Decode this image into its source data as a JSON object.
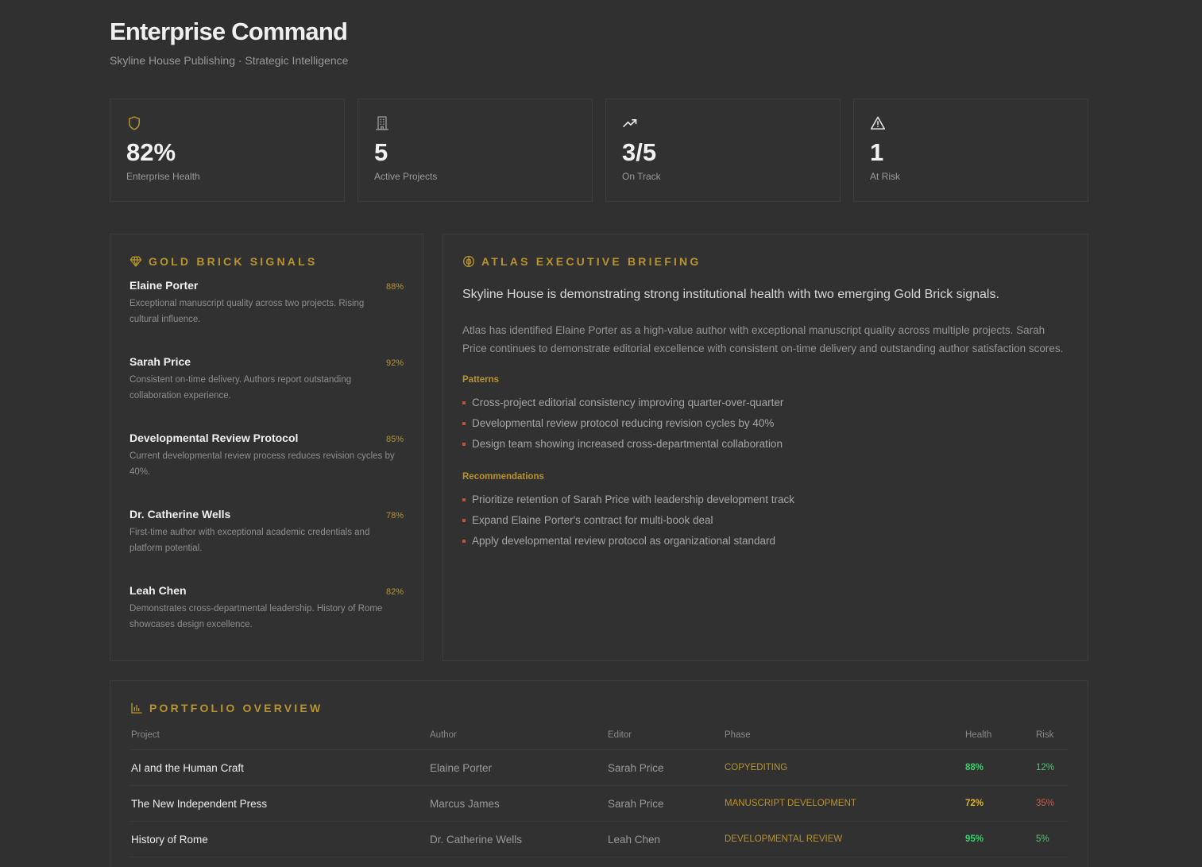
{
  "header": {
    "title": "Enterprise Command",
    "subtitle": "Skyline House Publishing · Strategic Intelligence"
  },
  "kpis": [
    {
      "icon": "shield-icon",
      "value": "82%",
      "label": "Enterprise Health"
    },
    {
      "icon": "building-icon",
      "value": "5",
      "label": "Active Projects"
    },
    {
      "icon": "trending-up-icon",
      "value": "3/5",
      "label": "On Track"
    },
    {
      "icon": "alert-triangle-icon",
      "value": "1",
      "label": "At Risk"
    }
  ],
  "signals": {
    "title": "GOLD BRICK SIGNALS",
    "items": [
      {
        "name": "Elaine Porter",
        "score": "88%",
        "desc": "Exceptional manuscript quality across two projects. Rising cultural influence."
      },
      {
        "name": "Sarah Price",
        "score": "92%",
        "desc": "Consistent on-time delivery. Authors report outstanding collaboration experience."
      },
      {
        "name": "Developmental Review Protocol",
        "score": "85%",
        "desc": "Current developmental review process reduces revision cycles by 40%."
      },
      {
        "name": "Dr. Catherine Wells",
        "score": "78%",
        "desc": "First-time author with exceptional academic credentials and platform potential."
      },
      {
        "name": "Leah Chen",
        "score": "82%",
        "desc": "Demonstrates cross-departmental leadership. History of Rome showcases design excellence."
      }
    ]
  },
  "briefing": {
    "title": "ATLAS EXECUTIVE BRIEFING",
    "lead": "Skyline House is demonstrating strong institutional health with two emerging Gold Brick signals.",
    "body": "Atlas has identified Elaine Porter as a high-value author with exceptional manuscript quality across multiple projects. Sarah Price continues to demonstrate editorial excellence with consistent on-time delivery and outstanding author satisfaction scores.",
    "patterns_label": "Patterns",
    "patterns": [
      "Cross-project editorial consistency improving quarter-over-quarter",
      "Developmental review protocol reducing revision cycles by 40%",
      "Design team showing increased cross-departmental collaboration"
    ],
    "recommendations_label": "Recommendations",
    "recommendations": [
      "Prioritize retention of Sarah Price with leadership development track",
      "Expand Elaine Porter's contract for multi-book deal",
      "Apply developmental review protocol as organizational standard"
    ]
  },
  "portfolio": {
    "title": "PORTFOLIO OVERVIEW",
    "columns": [
      "Project",
      "Author",
      "Editor",
      "Phase",
      "Health",
      "Risk"
    ],
    "rows": [
      {
        "project": "AI and the Human Craft",
        "author": "Elaine Porter",
        "editor": "Sarah Price",
        "phase": "COPYEDITING",
        "health": "88%",
        "risk": "12%",
        "health_color": "#3ecf6e",
        "risk_color": "#3ecf6e"
      },
      {
        "project": "The New Independent Press",
        "author": "Marcus James",
        "editor": "Sarah Price",
        "phase": "MANUSCRIPT DEVELOPMENT",
        "health": "72%",
        "risk": "35%",
        "health_color": "#e0b52c",
        "risk_color": "#e0573f"
      },
      {
        "project": "History of Rome",
        "author": "Dr. Catherine Wells",
        "editor": "Leah Chen",
        "phase": "DEVELOPMENTAL REVIEW",
        "health": "95%",
        "risk": "5%",
        "health_color": "#3ecf6e",
        "risk_color": "#3ecf6e"
      }
    ]
  },
  "colors": {
    "gold": "#b8932e",
    "bullet": "#c0503a",
    "background": "#303030"
  }
}
